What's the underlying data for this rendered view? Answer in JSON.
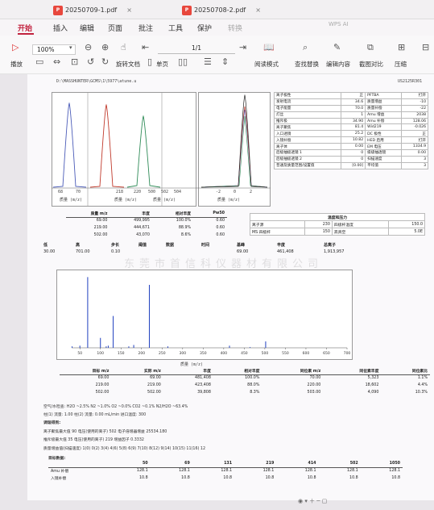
{
  "app": {
    "tabs": [
      {
        "label": "20250709-1.pdf",
        "close": "×"
      },
      {
        "label": "20250708-2.pdf",
        "close": "×"
      }
    ],
    "menu": [
      "开始",
      "插入",
      "编辑",
      "页面",
      "批注",
      "工具",
      "保护",
      "转换"
    ],
    "menu_search_hint": "WPS AI",
    "toolbar": {
      "play_label": "播放",
      "zoom_value": "100%",
      "page_value": "1/1",
      "rotate_label": "旋转文档",
      "single_page_label": "单页",
      "read_mode_label": "阅读模式",
      "find_replace_label": "查找替换",
      "edit_content_label": "编辑内容",
      "screenshot_compare_label": "截图对比",
      "compress_label": "压缩"
    }
  },
  "doc": {
    "path": "D:\\MASSHUNTER\\GCMS\\1\\5977\\atune.u",
    "serial": "US2125R301",
    "spectra": [
      {
        "ticks": [
          "68",
          "70"
        ],
        "xlabel": "质量 (m/z)",
        "peak_color": "#4a5bb8"
      },
      {
        "ticks": [
          "218",
          "220"
        ],
        "xlabel": "质量 (m/z)",
        "peak_color": "#c0392b"
      },
      {
        "ticks": [
          "500",
          "502",
          "504"
        ],
        "xlabel": "质量 (m/z)",
        "peak_color": "#2e8b57"
      },
      {
        "ticks": [
          "-2",
          "0",
          "2"
        ],
        "xlabel": "质量 (m/z)",
        "peak_color": "#222222"
      }
    ],
    "params": [
      [
        "离子极性",
        "正",
        "PFTBA",
        "打开"
      ],
      [
        "发射电流",
        "34.6",
        "质量增益",
        "-10"
      ],
      [
        "电子能量",
        "70.0",
        "质量补偿",
        "-22"
      ],
      [
        "灯丝",
        "1",
        "Amu 增益",
        "2038"
      ],
      [
        "推斥极",
        "34.90",
        "Amu 补偿",
        "128.06"
      ],
      [
        "离子聚焦",
        "81.4",
        "Wid219",
        "-0.026"
      ],
      [
        "入口透镜",
        "25.2",
        "DC 极性",
        "正"
      ],
      [
        "入镜补偿",
        "10.82",
        "HED 启用",
        "打开"
      ],
      [
        "离子体",
        "0.00",
        "EM 电压",
        "1334.9"
      ],
      [
        "后极抽极透镜 1",
        "0",
        "级级抽透镜",
        "0.00"
      ],
      [
        "后极抽极透镜 2",
        "0",
        "扫描速度",
        "3"
      ],
      [
        "普通及质量范围/设置值",
        "[0.00]",
        "平均值",
        "3"
      ]
    ],
    "temps": {
      "title": "温度和压力",
      "rows": [
        [
          "离子源",
          "230",
          "四极杆温度",
          "150.0"
        ],
        [
          "MS 四极杆",
          "150",
          "高真空",
          "5.0E"
        ]
      ]
    },
    "top_peaks": {
      "headers": [
        "质量 m/z",
        "丰度",
        "相对丰度",
        "Pw50"
      ],
      "rows": [
        [
          "69.00",
          "499,995",
          "100.0%",
          "0.60"
        ],
        [
          "219.00",
          "444,671",
          "88.9%",
          "0.60"
        ],
        [
          "502.00",
          "43,070",
          "8.6%",
          "0.60"
        ]
      ]
    },
    "summary": {
      "headers": [
        "低",
        "高",
        "步长",
        "阈值",
        "数据",
        "时间",
        "基峰",
        "丰度",
        "总离子"
      ],
      "values": [
        "30.00",
        "701.00",
        "0.10",
        "",
        "",
        "",
        "69.00",
        "461,408",
        "1,913,957"
      ]
    },
    "watermark": "东莞市首信科仪器材有限公司",
    "chart_data": {
      "type": "bar",
      "title": "",
      "xlabel": "质量 (m/z)",
      "ylabel": "",
      "xlim": [
        30,
        700
      ],
      "xticks": [
        50,
        100,
        150,
        200,
        250,
        300,
        350,
        400,
        450,
        500,
        550,
        600,
        650,
        700
      ],
      "ylim": [
        0,
        105
      ],
      "x": [
        31,
        50,
        69,
        100,
        114,
        119,
        131,
        169,
        181,
        219,
        264,
        414,
        464,
        502
      ],
      "values": [
        2,
        3,
        100,
        14,
        2,
        3,
        45,
        2,
        4,
        89,
        2,
        3,
        1,
        9
      ]
    },
    "iso": {
      "headers": [
        "目标 m/z",
        "实际 m/z",
        "丰度",
        "相对丰度",
        "同位素 m/z",
        "同位素丰度",
        "同位素比"
      ],
      "rows": [
        [
          "69.00",
          "69.00",
          "481,408",
          "100.0%",
          "70.00",
          "5,323",
          "1.1%"
        ],
        [
          "219.00",
          "219.00",
          "423,408",
          "88.0%",
          "220.00",
          "18,602",
          "4.4%"
        ],
        [
          "502.00",
          "502.00",
          "39,808",
          "8.3%",
          "503.00",
          "4,090",
          "10.3%"
        ]
      ]
    },
    "gas": {
      "air_water": "空气/水检查: H2O ~2.5% N2 ~1.0% O2 ~0.0% CO2 ~0.1% N2/H2O ~63.4%",
      "column_flow": "柱(1) 流量: 1.00   柱(2) 流量: 0.00 mL/min   进口温度: 300",
      "section": "调谐得到:",
      "rows": [
        "离子聚焦最大值   90   电压(使用的离子)   502   电子倍增器增益   25534.180",
        "推斥极最大值   35   电压(使用的离子)   219   增益因子   0.3332",
        "质量增益值(扫描速度)   1(0)   0(2)   3(4)   4(6)   5(8)   6(9)   7(10)   8(12)   9(14)   10(15)   11(16)   12"
      ]
    },
    "amu": {
      "section": "目标数据:",
      "headers": [
        "",
        "50",
        "69",
        "131",
        "219",
        "414",
        "502",
        "1050"
      ],
      "rows": [
        [
          "Amu 补偿",
          "128.1",
          "128.1",
          "128.1",
          "128.1",
          "128.1",
          "128.1",
          "128.1"
        ],
        [
          "入镜补偿",
          "10.8",
          "10.8",
          "10.8",
          "10.8",
          "10.8",
          "10.8",
          "10.8"
        ]
      ]
    }
  }
}
